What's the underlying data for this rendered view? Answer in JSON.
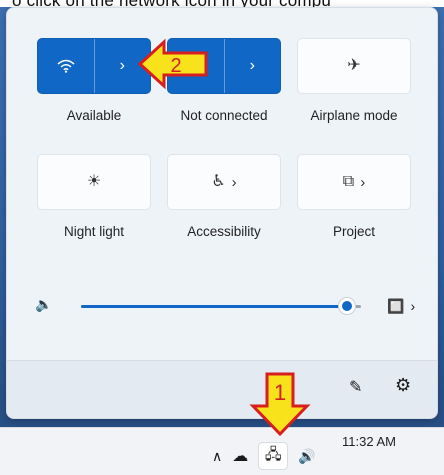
{
  "caption": "o click on the network icon in your compu",
  "tiles": [
    {
      "label": "Available",
      "active": true
    },
    {
      "label": "Not connected",
      "active": true
    },
    {
      "label": "Airplane mode",
      "active": false
    },
    {
      "label": "Night light",
      "active": false
    },
    {
      "label": "Accessibility",
      "active": false
    },
    {
      "label": "Project",
      "active": false
    }
  ],
  "icons": {
    "wifi": "wifi-icon",
    "chevron": "›",
    "airplane": "✈",
    "night_light": "☀",
    "accessibility": "♿",
    "project": "⧉",
    "volume": "🔈",
    "speaker_device": "🔲",
    "edit": "✎",
    "settings": "⚙",
    "tray_up": "∧",
    "cloud_off": "☁",
    "network": "🖧",
    "tray_volume": "🔊"
  },
  "volume": {
    "level": 0.95
  },
  "taskbar": {
    "time": "11:32 AM"
  },
  "callouts": [
    {
      "number": "2"
    },
    {
      "number": "1"
    }
  ],
  "colors": {
    "accent": "#1067c5",
    "callout_fill": "#f7e21b",
    "callout_stroke": "#d81f1f"
  }
}
